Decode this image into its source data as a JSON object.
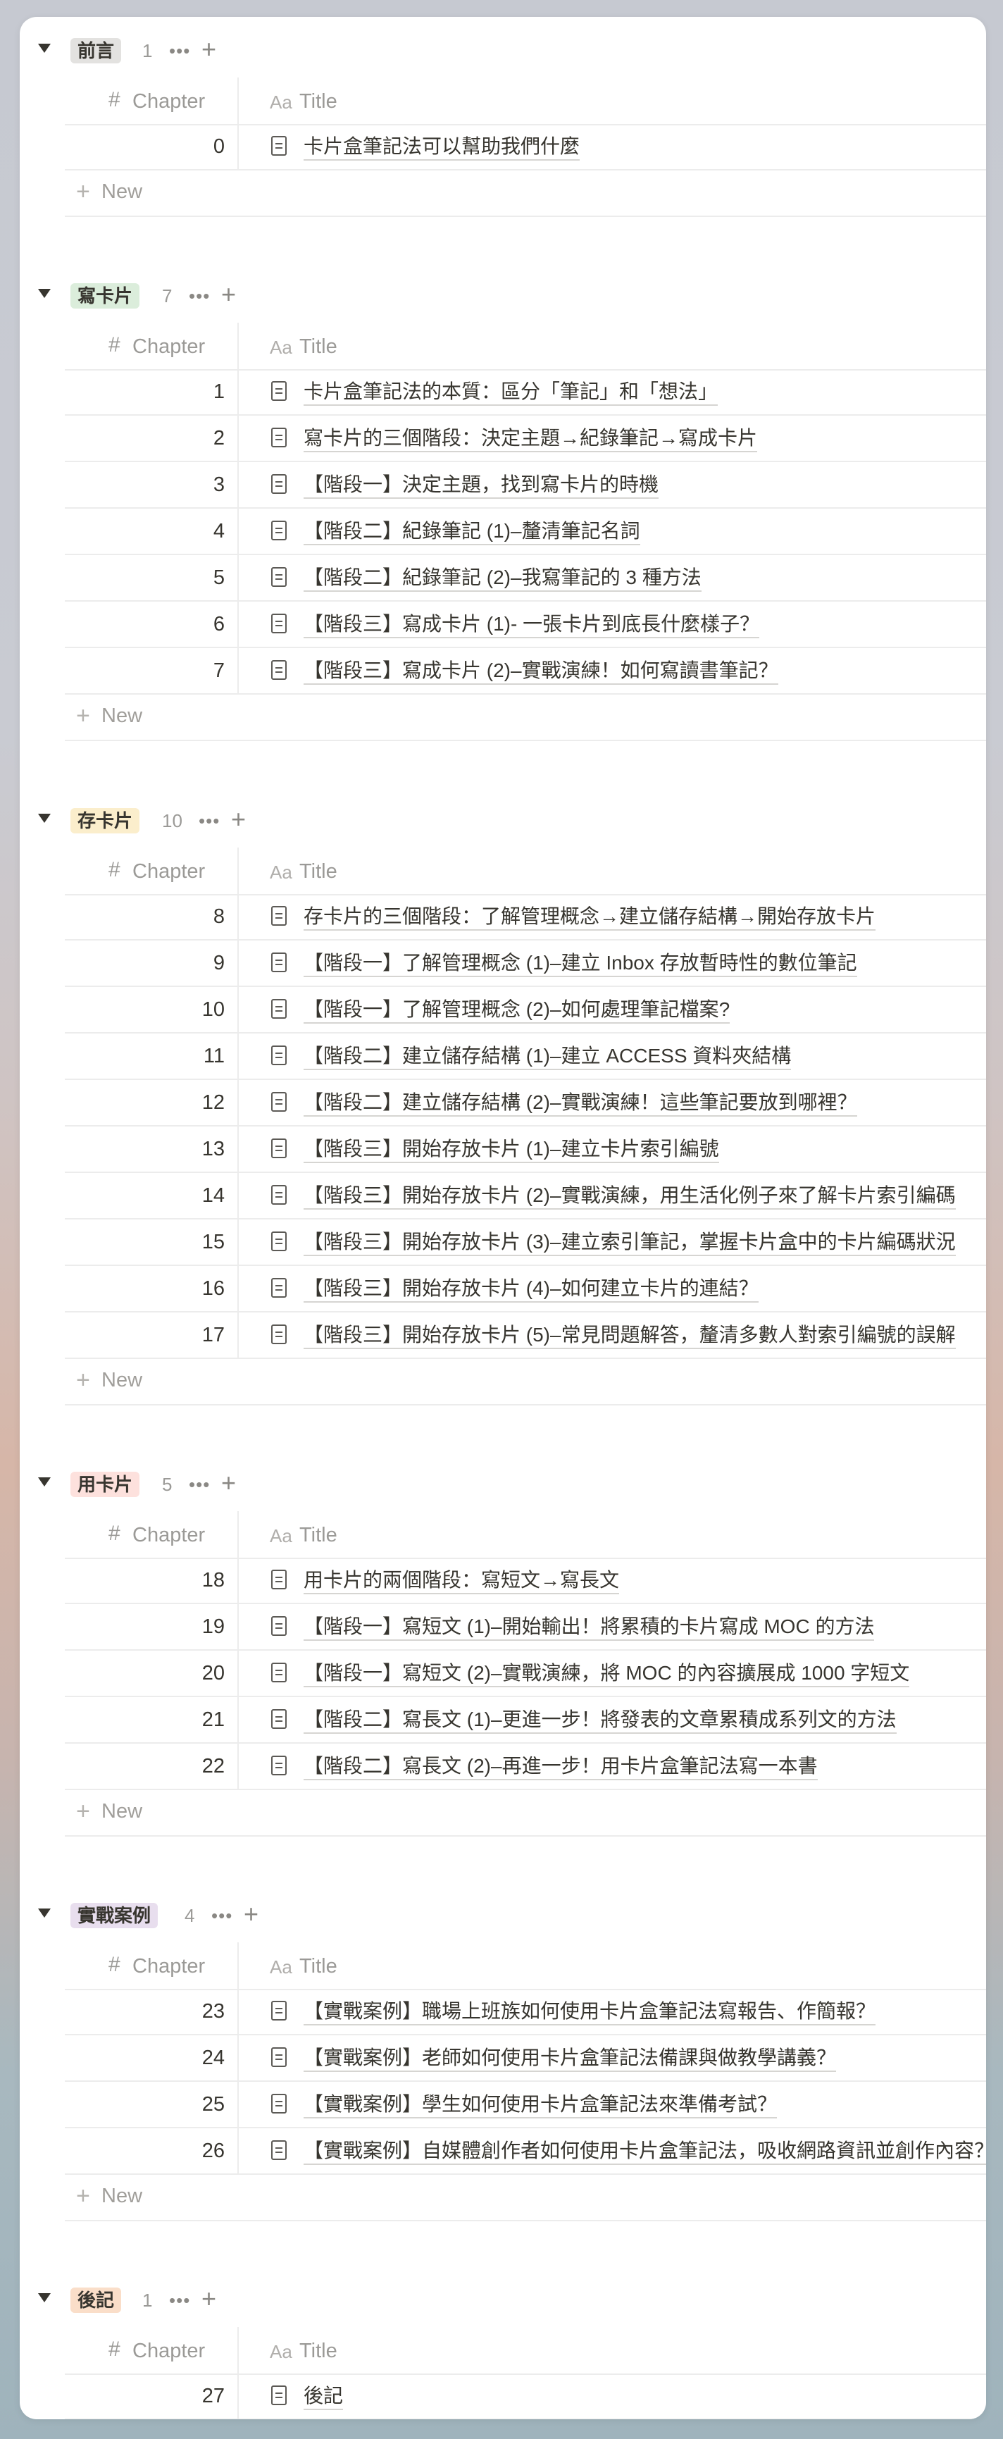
{
  "columns": {
    "chapter": "Chapter",
    "title": "Title",
    "title_icon": "Aa"
  },
  "new_label": "New",
  "groups": [
    {
      "name": "前言",
      "count": "1",
      "tag_color": "#e3e2e0",
      "rows": [
        {
          "chapter": "0",
          "title": "卡片盒筆記法可以幫助我們什麼"
        }
      ]
    },
    {
      "name": "寫卡片",
      "count": "7",
      "tag_color": "#dbeddb",
      "rows": [
        {
          "chapter": "1",
          "title": "卡片盒筆記法的本質：區分「筆記」和「想法」"
        },
        {
          "chapter": "2",
          "title": "寫卡片的三個階段：決定主題→紀錄筆記→寫成卡片"
        },
        {
          "chapter": "3",
          "title": "【階段一】決定主題，找到寫卡片的時機"
        },
        {
          "chapter": "4",
          "title": "【階段二】紀錄筆記 (1)–釐清筆記名詞"
        },
        {
          "chapter": "5",
          "title": "【階段二】紀錄筆記 (2)–我寫筆記的 3 種方法"
        },
        {
          "chapter": "6",
          "title": "【階段三】寫成卡片 (1)- 一張卡片到底長什麼樣子？"
        },
        {
          "chapter": "7",
          "title": "【階段三】寫成卡片 (2)–實戰演練！如何寫讀書筆記？"
        }
      ]
    },
    {
      "name": "存卡片",
      "count": "10",
      "tag_color": "#fbeecc",
      "rows": [
        {
          "chapter": "8",
          "title": "存卡片的三個階段：了解管理概念→建立儲存結構→開始存放卡片"
        },
        {
          "chapter": "9",
          "title": "【階段一】了解管理概念 (1)–建立 Inbox 存放暫時性的數位筆記"
        },
        {
          "chapter": "10",
          "title": "【階段一】了解管理概念 (2)–如何處理筆記檔案?"
        },
        {
          "chapter": "11",
          "title": "【階段二】建立儲存結構 (1)–建立 ACCESS 資料夾結構"
        },
        {
          "chapter": "12",
          "title": "【階段二】建立儲存結構 (2)–實戰演練！這些筆記要放到哪裡？"
        },
        {
          "chapter": "13",
          "title": "【階段三】開始存放卡片 (1)–建立卡片索引編號"
        },
        {
          "chapter": "14",
          "title": "【階段三】開始存放卡片 (2)–實戰演練，用生活化例子來了解卡片索引編碼"
        },
        {
          "chapter": "15",
          "title": "【階段三】開始存放卡片 (3)–建立索引筆記，掌握卡片盒中的卡片編碼狀況"
        },
        {
          "chapter": "16",
          "title": "【階段三】開始存放卡片 (4)–如何建立卡片的連結？"
        },
        {
          "chapter": "17",
          "title": "【階段三】開始存放卡片 (5)–常見問題解答，釐清多數人對索引編號的誤解"
        }
      ]
    },
    {
      "name": "用卡片",
      "count": "5",
      "tag_color": "#fde1dd",
      "rows": [
        {
          "chapter": "18",
          "title": "用卡片的兩個階段：寫短文→寫長文"
        },
        {
          "chapter": "19",
          "title": "【階段一】寫短文 (1)–開始輸出！將累積的卡片寫成 MOC 的方法"
        },
        {
          "chapter": "20",
          "title": "【階段一】寫短文 (2)–實戰演練，將 MOC 的內容擴展成 1000 字短文"
        },
        {
          "chapter": "21",
          "title": "【階段二】寫長文 (1)–更進一步！將發表的文章累積成系列文的方法"
        },
        {
          "chapter": "22",
          "title": "【階段二】寫長文 (2)–再進一步！用卡片盒筆記法寫一本書"
        }
      ]
    },
    {
      "name": "實戰案例",
      "count": "4",
      "tag_color": "#e8deee",
      "rows": [
        {
          "chapter": "23",
          "title": "【實戰案例】職場上班族如何使用卡片盒筆記法寫報告、作簡報？"
        },
        {
          "chapter": "24",
          "title": "【實戰案例】老師如何使用卡片盒筆記法備課與做教學講義？"
        },
        {
          "chapter": "25",
          "title": "【實戰案例】學生如何使用卡片盒筆記法來準備考試？"
        },
        {
          "chapter": "26",
          "title": "【實戰案例】自媒體創作者如何使用卡片盒筆記法，吸收網路資訊並創作內容？"
        }
      ]
    },
    {
      "name": "後記",
      "count": "1",
      "tag_color": "#fadec9",
      "rows": [
        {
          "chapter": "27",
          "title": "後記"
        }
      ]
    }
  ]
}
